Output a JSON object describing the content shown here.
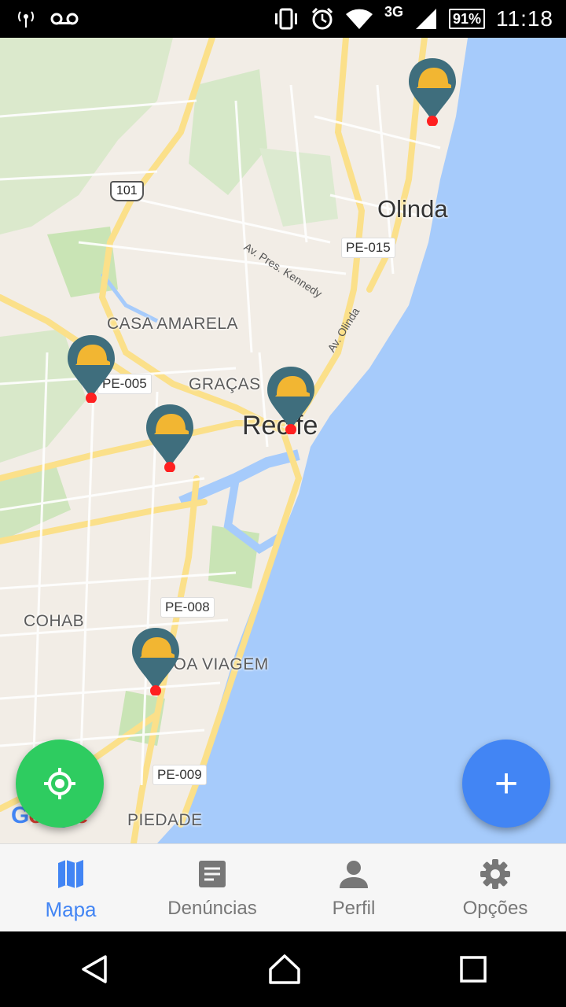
{
  "status_bar": {
    "network": "3G",
    "battery": "91%",
    "time": "11:18",
    "icons": [
      "radio-signal-icon",
      "voicemail-icon",
      "vibrate-icon",
      "alarm-icon",
      "wifi-icon",
      "cellular-signal-icon",
      "battery-icon"
    ]
  },
  "map": {
    "places": {
      "olinda": "Olinda",
      "recife": "Recife",
      "casa_amarela": "CASA AMARELA",
      "gracas": "GRAÇAS",
      "cohab": "COHAB",
      "boa_viagem": "BOA VIAGEM",
      "piedade": "PIEDADE"
    },
    "roads": {
      "r101": "101",
      "pe015": "PE-015",
      "pe005": "PE-005",
      "pe008": "PE-008",
      "pe009": "PE-009",
      "pres_kennedy": "Av. Pres. Kennedy",
      "av_olinda": "Av. Olinda"
    },
    "markers": [
      "construction-report",
      "construction-report",
      "construction-report",
      "construction-report",
      "construction-report"
    ],
    "attribution": "Google",
    "colors": {
      "water": "#a6cbfb",
      "land": "#f2ede6",
      "park": "#cfe8c2",
      "road": "#fbe08a",
      "marker": "#3f6e7d",
      "helmet": "#f2b632",
      "marker_dot": "#ff2020"
    }
  },
  "fabs": {
    "locate_icon": "gps-locate-icon",
    "add_label": "+"
  },
  "bottom_nav": {
    "items": [
      {
        "label": "Mapa",
        "icon": "map-icon",
        "active": true
      },
      {
        "label": "Denúncias",
        "icon": "document-icon",
        "active": false
      },
      {
        "label": "Perfil",
        "icon": "person-icon",
        "active": false
      },
      {
        "label": "Opções",
        "icon": "gear-icon",
        "active": false
      }
    ],
    "active_color": "#4285f4"
  },
  "system_nav": {
    "icons": [
      "back-icon",
      "home-icon",
      "recents-icon"
    ]
  }
}
